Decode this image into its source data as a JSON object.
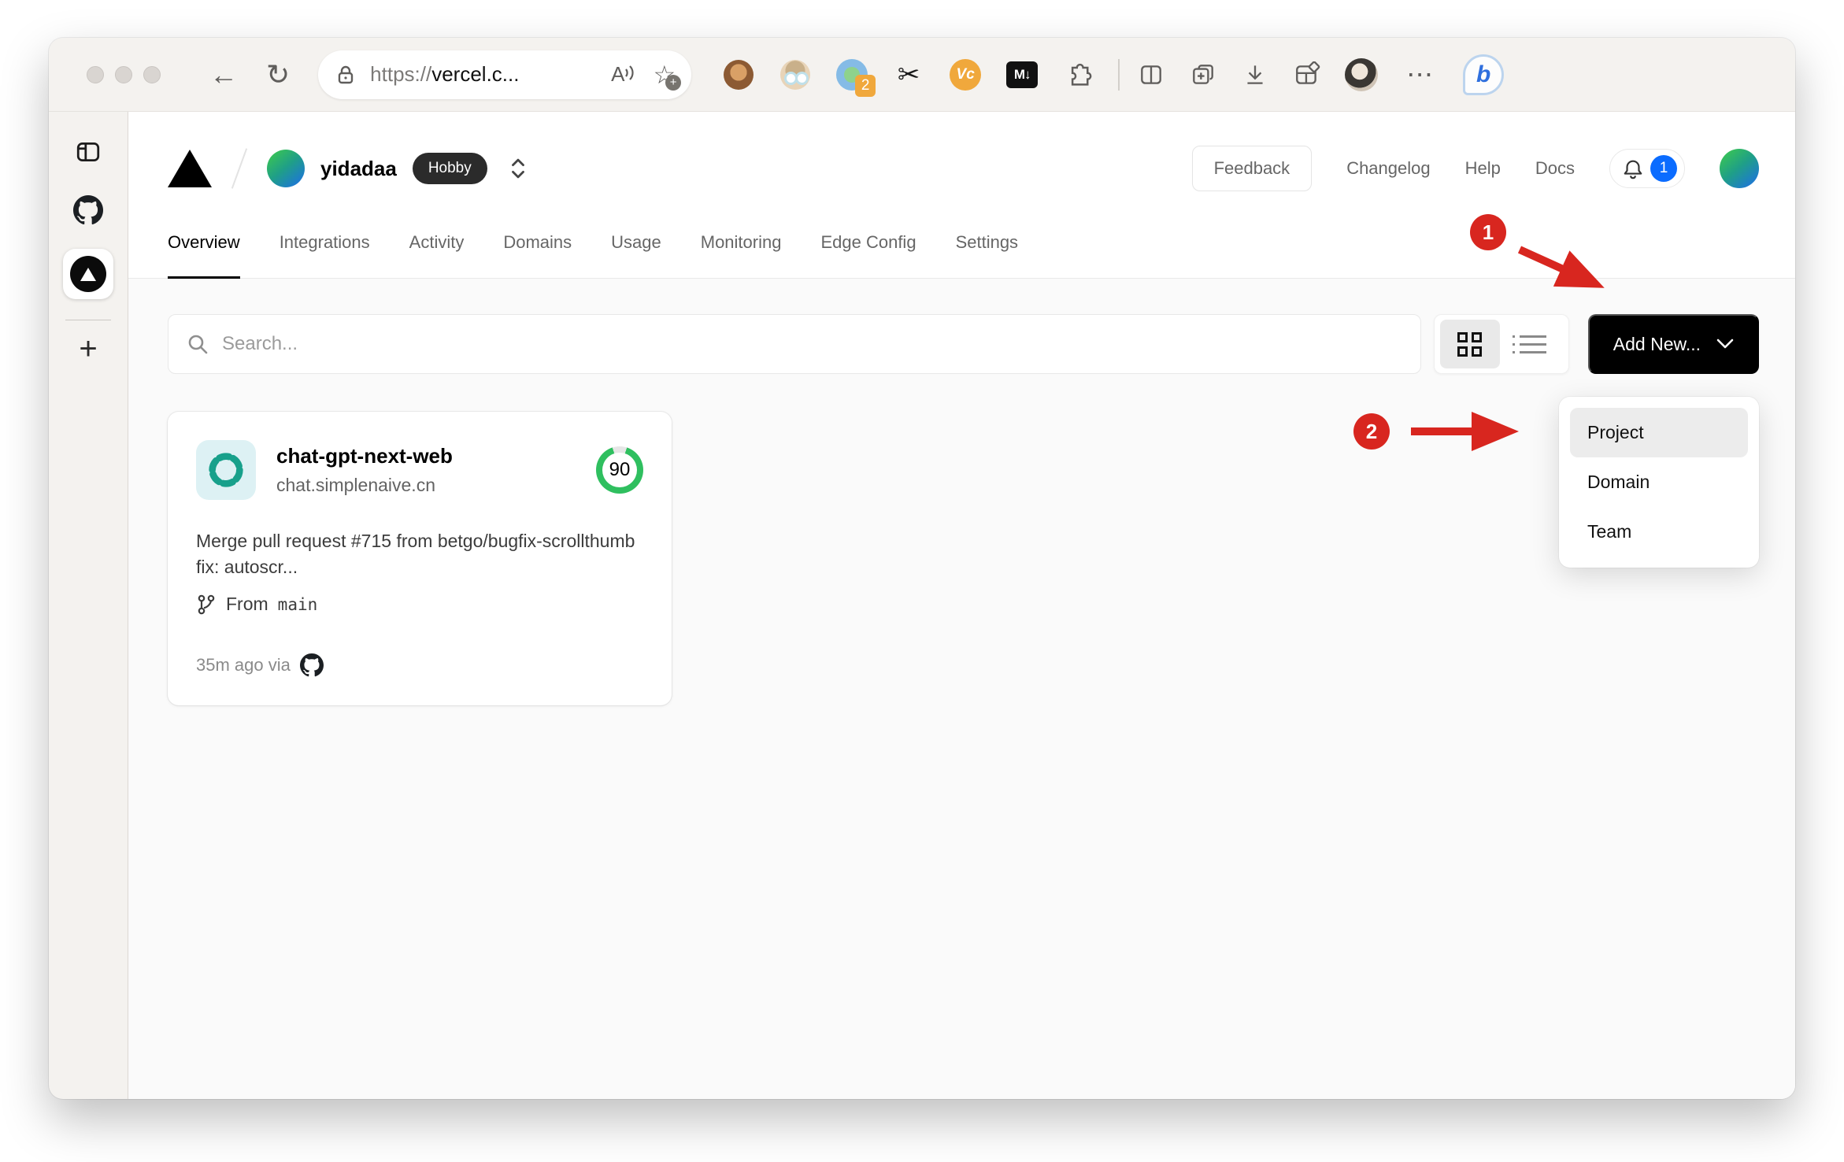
{
  "browser": {
    "url_scheme": "https://",
    "url_host": "vercel.c...",
    "extension_badge": "2",
    "icons": {
      "back": "←",
      "reload": "↻",
      "more": "⋯",
      "scissors": "✂",
      "vc_label": "Vc",
      "markdown_label": "M↓",
      "bing_label": "b",
      "star": "☆",
      "star_plus": "+",
      "read_aloud": "A",
      "new_tab": "+"
    }
  },
  "vercel": {
    "team": {
      "name": "yidadaa",
      "plan": "Hobby"
    },
    "header_links": {
      "feedback": "Feedback",
      "changelog": "Changelog",
      "help": "Help",
      "docs": "Docs"
    },
    "notification_count": "1",
    "tabs": [
      {
        "label": "Overview",
        "active": true
      },
      {
        "label": "Integrations"
      },
      {
        "label": "Activity"
      },
      {
        "label": "Domains"
      },
      {
        "label": "Usage"
      },
      {
        "label": "Monitoring"
      },
      {
        "label": "Edge Config"
      },
      {
        "label": "Settings"
      }
    ],
    "toolbar": {
      "search_placeholder": "Search...",
      "add_new_label": "Add New..."
    },
    "dropdown": {
      "items": [
        {
          "label": "Project",
          "highlighted": true
        },
        {
          "label": "Domain"
        },
        {
          "label": "Team"
        }
      ]
    },
    "project_card": {
      "name": "chat-gpt-next-web",
      "domain": "chat.simplenaive.cn",
      "score": "90",
      "commit_message": "Merge pull request #715 from betgo/bugfix-scrollthumb fix: autoscr...",
      "branch_label": "From",
      "branch_name": "main",
      "deployed": "35m ago via"
    }
  },
  "annotations": {
    "step1": "1",
    "step2": "2"
  },
  "colors": {
    "accent_blue": "#0b6cff",
    "score_green": "#2fbf5f",
    "score_track": "#e6e6e6",
    "annotation_red": "#d8261f",
    "button_black": "#000000",
    "hobby_badge": "#2b2b2b",
    "extension_badge_orange": "#f0a83c"
  }
}
